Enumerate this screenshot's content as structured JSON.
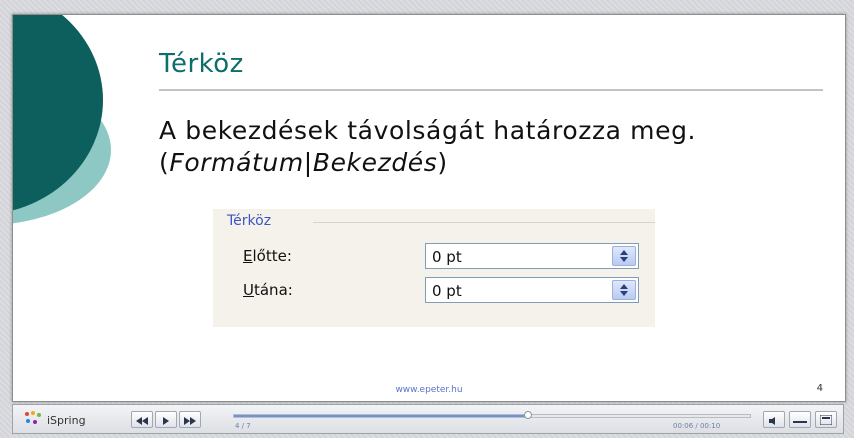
{
  "slide": {
    "title": "Térköz",
    "body_plain": "A bekezdések távolságát határozza meg. (",
    "body_italic_1": "Formátum",
    "body_sep": "|",
    "body_italic_2": "Bekezdés",
    "body_close": ")",
    "footer_url": "www.epeter.hu",
    "page_number": "4"
  },
  "dialog": {
    "group_label": "Térköz",
    "fields": [
      {
        "label_underlined": "E",
        "label_rest": "lőtte:",
        "value": "0 pt"
      },
      {
        "label_underlined": "U",
        "label_rest": "tána:",
        "value": "0 pt"
      }
    ]
  },
  "player": {
    "logo_text": "iSpring",
    "slide_counter": "4 / 7",
    "time": "00:06 / 00:10",
    "progress_fraction": 0.57
  },
  "colors": {
    "accent_dark": "#0c5f5c",
    "accent_light": "#8ec8c5",
    "title": "#0e6e6a",
    "group_label": "#3b56c4",
    "progress": "#6d93d8"
  },
  "icons": [
    "ispring-logo-icon",
    "rewind-icon",
    "play-icon",
    "fast-forward-icon",
    "spinner-arrows-icon",
    "volume-icon",
    "outline-icon",
    "menu-icon"
  ]
}
